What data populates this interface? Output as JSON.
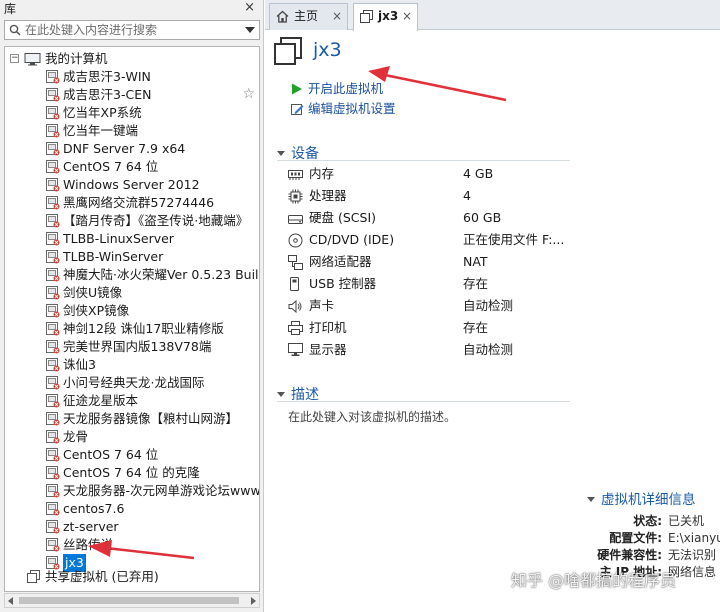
{
  "library": {
    "title": "库",
    "close": "×",
    "search_placeholder": "在此处键入内容进行搜索",
    "root_label": "我的计算机",
    "vms": [
      {
        "label": "成吉思汗3-WIN"
      },
      {
        "label": "成吉思汗3-CEN"
      },
      {
        "label": "忆当年XP系统"
      },
      {
        "label": "忆当年一键端"
      },
      {
        "label": "DNF Server 7.9 x64"
      },
      {
        "label": "CentOS 7 64 位"
      },
      {
        "label": "Windows Server 2012"
      },
      {
        "label": "黑鹰网络交流群57274446"
      },
      {
        "label": "【踏月传奇】《盗圣传说·地藏端》"
      },
      {
        "label": "TLBB-LinuxServer"
      },
      {
        "label": "TLBB-WinServer"
      },
      {
        "label": "神魔大陆·冰火荣耀Ver 0.5.23 Build"
      },
      {
        "label": "剑侠U镜像"
      },
      {
        "label": "剑侠XP镜像"
      },
      {
        "label": "神剑12段 诛仙17职业精修版"
      },
      {
        "label": "完美世界国内版138V78端"
      },
      {
        "label": "诛仙3"
      },
      {
        "label": "小问号经典天龙·龙战国际"
      },
      {
        "label": "征途龙星版本"
      },
      {
        "label": "天龙服务器镜像【粮村山网游】"
      },
      {
        "label": "龙骨"
      },
      {
        "label": "CentOS 7 64 位"
      },
      {
        "label": "CentOS 7 64 位 的克隆"
      },
      {
        "label": "天龙服务器-次元网单游戏论坛www"
      },
      {
        "label": "centos7.6"
      },
      {
        "label": "zt-server"
      },
      {
        "label": "丝路传说"
      },
      {
        "label": "jx3"
      }
    ],
    "shared_label": "共享虚拟机 (已弃用)"
  },
  "tabs": {
    "home_label": "主页",
    "active_label": "jx3",
    "close": "×"
  },
  "vm": {
    "name": "jx3",
    "actions": {
      "power_on": "开启此虚拟机",
      "edit_settings": "编辑虚拟机设置"
    },
    "devices_header": "设备",
    "devices": [
      {
        "icon": "memory-icon",
        "name": "内存",
        "value": "4 GB"
      },
      {
        "icon": "processor-icon",
        "name": "处理器",
        "value": "4"
      },
      {
        "icon": "hard-disk-icon",
        "name": "硬盘 (SCSI)",
        "value": "60 GB"
      },
      {
        "icon": "cd-dvd-icon",
        "name": "CD/DVD (IDE)",
        "value": "正在使用文件 F:..."
      },
      {
        "icon": "network-adapter-icon",
        "name": "网络适配器",
        "value": "NAT"
      },
      {
        "icon": "usb-icon",
        "name": "USB 控制器",
        "value": "存在"
      },
      {
        "icon": "sound-card-icon",
        "name": "声卡",
        "value": "自动检测"
      },
      {
        "icon": "printer-icon",
        "name": "打印机",
        "value": "存在"
      },
      {
        "icon": "display-icon",
        "name": "显示器",
        "value": "自动检测"
      }
    ],
    "description_header": "描述",
    "description_placeholder": "在此处键入对该虚拟机的描述。",
    "details_header": "虚拟机详细信息",
    "details": [
      {
        "key": "状态:",
        "value": "已关机"
      },
      {
        "key": "配置文件:",
        "value": "E:\\xianyu"
      },
      {
        "key": "硬件兼容性:",
        "value": "无法识别"
      },
      {
        "key": "主 IP 地址:",
        "value": "网络信息"
      }
    ]
  },
  "watermark": "知乎 @啥都搞的程序员",
  "colors": {
    "accent": "#1b5aa6",
    "selection": "#0078d7",
    "annotation_arrow": "#e0303a",
    "play": "#22a229"
  }
}
